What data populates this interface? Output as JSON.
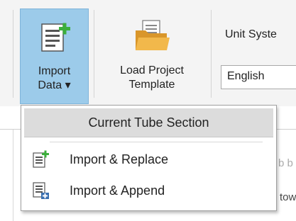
{
  "ribbon": {
    "import_button": {
      "line1": "Import",
      "line2": "Data ▾",
      "icon": "import-data-icon"
    },
    "load_button": {
      "line1": "Load Project",
      "line2": "Template",
      "icon": "folder-icon"
    },
    "unit_system": {
      "label": "Unit Syste",
      "value": "English"
    }
  },
  "background": {
    "cell_a": "b b",
    "cell_b": "tow"
  },
  "dropdown": {
    "header": "Current Tube Section",
    "items": [
      {
        "label": "Import & Replace",
        "icon": "import-replace-icon"
      },
      {
        "label": "Import & Append",
        "icon": "import-append-icon"
      }
    ]
  },
  "colors": {
    "ribbon_bg": "#f4f4f4",
    "button_active": "#9ccbea",
    "header_bg": "#dcdcdc",
    "icon_green": "#3cae3c",
    "icon_blue": "#3a6fb0"
  }
}
